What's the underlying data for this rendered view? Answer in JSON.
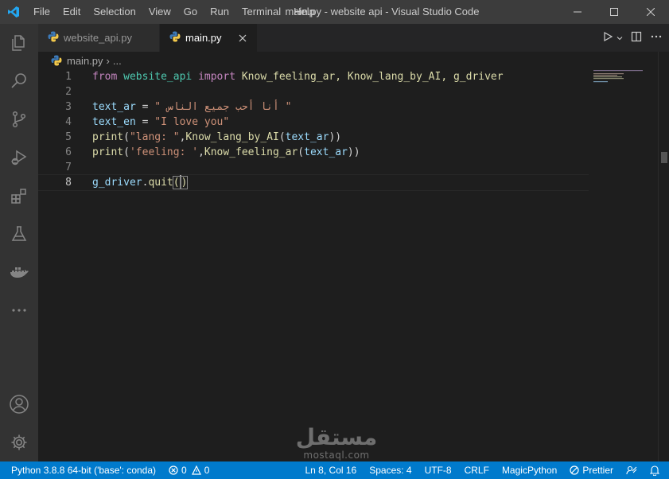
{
  "titlebar": {
    "menu": [
      "File",
      "Edit",
      "Selection",
      "View",
      "Go",
      "Run",
      "Terminal",
      "Help"
    ],
    "window_title": "main.py - website api - Visual Studio Code",
    "icons": [
      "vscode-logo-icon",
      "minimize-icon",
      "maximize-icon",
      "close-icon"
    ],
    "accent": "#007acc"
  },
  "activitybar": {
    "icons": [
      "explorer-icon",
      "search-icon",
      "source-control-icon",
      "run-debug-icon",
      "extensions-icon",
      "testing-icon",
      "docker-icon",
      "more-icon",
      "accounts-icon",
      "settings-gear-icon"
    ]
  },
  "tabs": [
    {
      "label": "website_api.py",
      "active": false
    },
    {
      "label": "main.py",
      "active": true
    }
  ],
  "breadcrumb": {
    "file": "main.py",
    "separator": "›",
    "more": "..."
  },
  "editor": {
    "current_line": 8,
    "lines": [
      {
        "num": "1"
      },
      {
        "num": "2"
      },
      {
        "num": "3"
      },
      {
        "num": "4"
      },
      {
        "num": "5"
      },
      {
        "num": "6"
      },
      {
        "num": "7"
      },
      {
        "num": "8"
      }
    ],
    "tokens": {
      "l1_from": "from",
      "l1_mod": "website_api",
      "l1_import": "import",
      "l1_names": "Know_feeling_ar, Know_lang_by_AI, g_driver",
      "l3_var": "text_ar",
      "l3_eq": " = ",
      "l3_str": "\" أنا أحب جميع الناس \"",
      "l4_var": "text_en",
      "l4_eq": " = ",
      "l4_str": "\"I love you\"",
      "l5_print": "print",
      "l5_p1": "(",
      "l5_str": "\"lang: \"",
      "l5_comma": ",",
      "l5_fn": "Know_lang_by_AI",
      "l5_p2": "(",
      "l5_arg": "text_ar",
      "l5_p3": "))",
      "l6_print": "print",
      "l6_p1": "(",
      "l6_str": "'feeling: '",
      "l6_comma": ",",
      "l6_fn": "Know_feeling_ar",
      "l6_p2": "(",
      "l6_arg": "text_ar",
      "l6_p3": "))",
      "l8_var": "g_driver",
      "l8_dot": ".",
      "l8_fn": "quit",
      "l8_open": "(",
      "l8_close": ")"
    }
  },
  "watermark": {
    "arabic": "مستقل",
    "latin": "mostaql.com"
  },
  "statusbar": {
    "python": "Python 3.8.8 64-bit ('base': conda)",
    "errors": "0",
    "warnings": "0",
    "position": "Ln 8, Col 16",
    "spaces": "Spaces: 4",
    "encoding": "UTF-8",
    "eol": "CRLF",
    "language": "MagicPython",
    "prettier": "Prettier",
    "color": "#007acc"
  }
}
